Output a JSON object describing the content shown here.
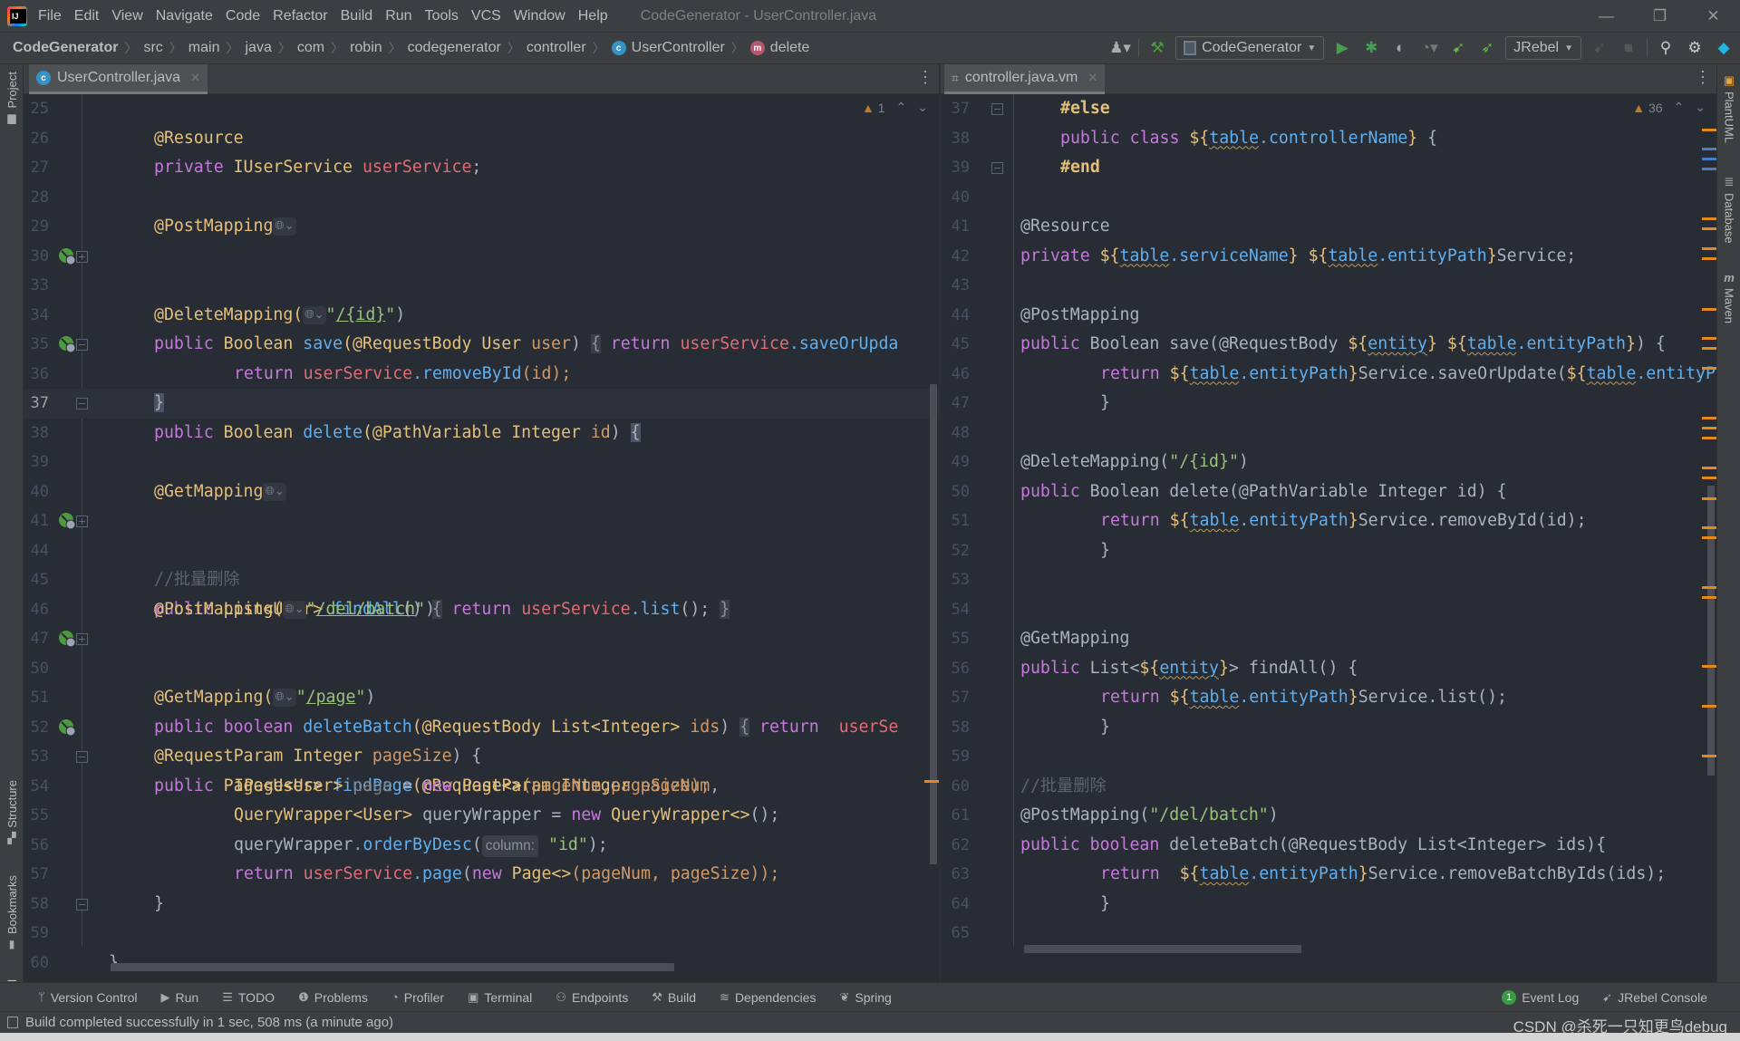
{
  "window": {
    "title": "CodeGenerator - UserController.java",
    "menu": [
      "File",
      "Edit",
      "View",
      "Navigate",
      "Code",
      "Refactor",
      "Build",
      "Run",
      "Tools",
      "VCS",
      "Window",
      "Help"
    ],
    "controls": {
      "minimize": "—",
      "restore": "❐",
      "close": "✕"
    }
  },
  "breadcrumb": {
    "items": [
      "CodeGenerator",
      "src",
      "main",
      "java",
      "com",
      "robin",
      "codegenerator",
      "controller"
    ],
    "class_badge": "c",
    "class_name": "UserController",
    "method_badge": "m",
    "method_name": "delete"
  },
  "toolbar": {
    "run_config": "CodeGenerator",
    "jrebel_config": "JRebel",
    "icons": [
      "account-icon",
      "build-hammer-icon",
      "run-icon",
      "debug-icon",
      "coverage-icon",
      "profiler-icon",
      "jrebel-run-icon",
      "jrebel-debug-icon",
      "stop-icon",
      "search-icon",
      "settings-icon",
      "toolbox-icon"
    ]
  },
  "left_tool_strip": {
    "project": "Project",
    "structure": "Structure",
    "bookmarks": "Bookmarks",
    "jrebel": "JRebel"
  },
  "right_tool_strip": {
    "plantuml": "PlantUML",
    "database": "Database",
    "maven": "Maven"
  },
  "left_editor": {
    "tab": {
      "name": "UserController.java",
      "badge": "c"
    },
    "inspection": {
      "warnings": "1"
    },
    "current_line": "37",
    "lines": [
      {
        "n": "25"
      },
      {
        "n": "26"
      },
      {
        "n": "27"
      },
      {
        "n": "28"
      },
      {
        "n": "29"
      },
      {
        "n": "30"
      },
      {
        "n": "33"
      },
      {
        "n": "34"
      },
      {
        "n": "35"
      },
      {
        "n": "36"
      },
      {
        "n": "37"
      },
      {
        "n": "38"
      },
      {
        "n": "39"
      },
      {
        "n": "40"
      },
      {
        "n": "41"
      },
      {
        "n": "44"
      },
      {
        "n": "45"
      },
      {
        "n": "46"
      },
      {
        "n": "47"
      },
      {
        "n": "50"
      },
      {
        "n": "51"
      },
      {
        "n": "52"
      },
      {
        "n": "53"
      },
      {
        "n": "54"
      },
      {
        "n": "55"
      },
      {
        "n": "56"
      },
      {
        "n": "57"
      },
      {
        "n": "58"
      },
      {
        "n": "59"
      },
      {
        "n": "60"
      }
    ],
    "code": {
      "l26": "@Resource",
      "l27_kw": "private",
      "l27_type": "IUserService",
      "l27_field": "userService",
      "l27_end": ";",
      "l29": "@PostMapping",
      "l30_kw": "public",
      "l30_type": "Boolean",
      "l30_fn": "save",
      "l30_a": "(@RequestBody",
      "l30_t2": "User",
      "l30_p": "user",
      "l30_b": ")",
      "l30_open": "{",
      "l30_ret": "return",
      "l30_f": "userService",
      "l30_call": ".saveOrUpda",
      "l34_a": "@DeleteMapping(",
      "l34_s1": "\"",
      "l34_s2": "/{id}",
      "l34_s3": "\"",
      "l34_e": ")",
      "l35_kw": "public",
      "l35_type": "Boolean",
      "l35_fn": "delete",
      "l35_a": "(@PathVariable",
      "l35_t2": "Integer",
      "l35_p": "id",
      "l35_b": ") ",
      "l35_open": "{",
      "l36_ret": "return",
      "l36_f": "userService",
      "l36_call": ".removeById",
      "l36_args": "(id);",
      "l37": "}",
      "l40": "@GetMapping",
      "l41_kw": "public",
      "l41_type": "List<User>",
      "l41_fn": "findAll",
      "l41_b": "()",
      "l41_open": "{",
      "l41_ret": "return",
      "l41_f": "userService",
      "l41_call": ".list",
      "l41_end": "();",
      "l41_close": "}",
      "l45": "//批量删除",
      "l46_a": "@PostMapping(",
      "l46_s1": "\"",
      "l46_s2": "/del/batch",
      "l46_s3": "\"",
      "l46_e": ")",
      "l47_kw": "public",
      "l47_type": "boolean",
      "l47_fn": "deleteBatch",
      "l47_a": "(@RequestBody",
      "l47_t2": "List<Integer>",
      "l47_p": "ids",
      "l47_b": ")",
      "l47_open": "{",
      "l47_ret": "return",
      "l47_f": "userSe",
      "l51_a": "@GetMapping(",
      "l51_s1": "\"",
      "l51_s2": "/page",
      "l51_s3": "\"",
      "l51_e": ")",
      "l52_kw": "public",
      "l52_type": "Page<User>",
      "l52_fn": "findPage",
      "l52_a": "(@RequestParam",
      "l52_t2": "Integer",
      "l52_p": "pageNum",
      "l52_e": ",",
      "l53_a": "@RequestParam",
      "l53_t": "Integer",
      "l53_p": "pageSize",
      "l53_e": ") {",
      "l54_t": "IPage<User>",
      "l54_v": "page",
      "l54_eq": " = ",
      "l54_new": "new",
      "l54_t2": "Page<>",
      "l54_args": "(pageNum,pageSize);",
      "l55_t": "QueryWrapper<User>",
      "l55_v": "queryWrapper",
      "l55_eq": " = ",
      "l55_new": "new",
      "l55_t2": "QueryWrapper<>",
      "l55_e": "();",
      "l56_v": "queryWrapper",
      "l56_call": ".orderByDesc",
      "l56_o": "(",
      "l56_hint": "column:",
      "l56_s": "\"id\"",
      "l56_e": ");",
      "l57_ret": "return",
      "l57_f": "userService",
      "l57_call": ".page",
      "l57_o": "(",
      "l57_new": "new",
      "l57_t": "Page<>",
      "l57_args": "(pageNum, pageSize));",
      "l58": "}",
      "l60": "}"
    }
  },
  "right_editor": {
    "tab": {
      "name": "controller.java.vm"
    },
    "inspection": {
      "warnings": "36"
    },
    "lines": [
      "37",
      "38",
      "39",
      "40",
      "41",
      "42",
      "43",
      "44",
      "45",
      "46",
      "47",
      "48",
      "49",
      "50",
      "51",
      "52",
      "53",
      "54",
      "55",
      "56",
      "57",
      "58",
      "59",
      "60",
      "61",
      "62",
      "63",
      "64",
      "65"
    ],
    "code": {
      "l37": "#else",
      "l38_kw": "public class",
      "l38_d": "${",
      "l38_v1": "table",
      "l38_v2": ".controllerName",
      "l38_c": "}",
      "l38_e": " {",
      "l39": "#end",
      "l41": "@Resource",
      "l42_kw": "private",
      "l42_d1": "${",
      "l42_v1": "table",
      "l42_v2": ".serviceName",
      "l42_c1": "}",
      "l42_d2": "${",
      "l42_v3": "table",
      "l42_v4": ".entityPath",
      "l42_c2": "}",
      "l42_e": "Service;",
      "l44": "@PostMapping",
      "l45_kw": "public",
      "l45_a": "Boolean save(@RequestBody",
      "l45_d1": "${",
      "l45_v1": "entity",
      "l45_c1": "}",
      "l45_d2": "${",
      "l45_v2": "table",
      "l45_v3": ".entityPath",
      "l45_c2": "}",
      "l45_e": ") {",
      "l46_ret": "return",
      "l46_d1": "${",
      "l46_v1": "table",
      "l46_v2": ".entityPath",
      "l46_c1": "}",
      "l46_m": "Service.saveOrUpdate(",
      "l46_d2": "${",
      "l46_v3": "table",
      "l46_v4": ".entityP",
      "l47": "}",
      "l49_a": "@DeleteMapping(",
      "l49_s": "\"/{id}\"",
      "l49_e": ")",
      "l50_kw": "public",
      "l50_a": "Boolean delete(@PathVariable Integer id) {",
      "l51_ret": "return",
      "l51_d": "${",
      "l51_v1": "table",
      "l51_v2": ".entityPath",
      "l51_c": "}",
      "l51_m": "Service.removeById(id);",
      "l52": "}",
      "l55": "@GetMapping",
      "l56_kw": "public",
      "l56_a": "List<",
      "l56_d": "${",
      "l56_v": "entity",
      "l56_c": "}",
      "l56_e": "> findAll() {",
      "l57_ret": "return",
      "l57_d": "${",
      "l57_v1": "table",
      "l57_v2": ".entityPath",
      "l57_c": "}",
      "l57_m": "Service.list();",
      "l58": "}",
      "l60": "//批量删除",
      "l61_a": "@PostMapping(",
      "l61_s": "\"/del/batch\"",
      "l61_e": ")",
      "l62_kw": "public",
      "l62_kw2": "boolean",
      "l62_a": "deleteBatch(@RequestBody List<Integer> ids){",
      "l63_ret": "return",
      "l63_d": "${",
      "l63_v1": "table",
      "l63_v2": ".entityPath",
      "l63_c": "}",
      "l63_m": "Service.removeBatchByIds(ids);",
      "l64": "}"
    }
  },
  "tool_windows": {
    "left": [
      "Version Control",
      "Run",
      "TODO",
      "Problems",
      "Profiler",
      "Terminal",
      "Endpoints",
      "Build",
      "Dependencies",
      "Spring"
    ],
    "event_log": "Event Log",
    "event_log_count": "1",
    "jrebel_console": "JRebel Console"
  },
  "status": {
    "message": "Build completed successfully in 1 sec, 508 ms (a minute ago)",
    "watermark": "CSDN @杀死一只知更鸟debug"
  },
  "colors": {
    "editor_bg": "#282c34",
    "chrome_bg": "#3c3f41",
    "keyword": "#c678dd",
    "type": "#e5c07b",
    "function": "#61afef",
    "field": "#e06c75",
    "string": "#98c379",
    "warning": "#c07d27"
  }
}
